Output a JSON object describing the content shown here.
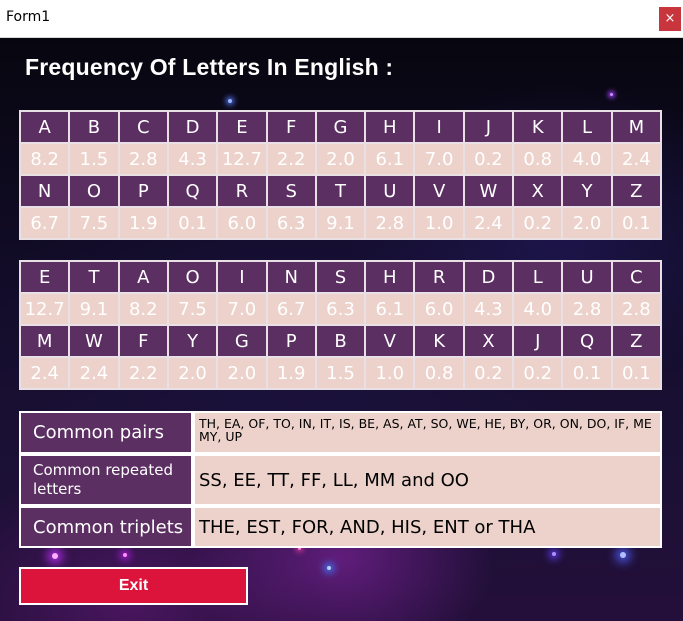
{
  "window": {
    "title": "Form1",
    "close_label": "×"
  },
  "heading": "Frequency Of Letters In English :",
  "alphabetical": [
    {
      "letter": "A",
      "freq": "8.2"
    },
    {
      "letter": "B",
      "freq": "1.5"
    },
    {
      "letter": "C",
      "freq": "2.8"
    },
    {
      "letter": "D",
      "freq": "4.3"
    },
    {
      "letter": "E",
      "freq": "12.7"
    },
    {
      "letter": "F",
      "freq": "2.2"
    },
    {
      "letter": "G",
      "freq": "2.0"
    },
    {
      "letter": "H",
      "freq": "6.1"
    },
    {
      "letter": "I",
      "freq": "7.0"
    },
    {
      "letter": "J",
      "freq": "0.2"
    },
    {
      "letter": "K",
      "freq": "0.8"
    },
    {
      "letter": "L",
      "freq": "4.0"
    },
    {
      "letter": "M",
      "freq": "2.4"
    },
    {
      "letter": "N",
      "freq": "6.7"
    },
    {
      "letter": "O",
      "freq": "7.5"
    },
    {
      "letter": "P",
      "freq": "1.9"
    },
    {
      "letter": "Q",
      "freq": "0.1"
    },
    {
      "letter": "R",
      "freq": "6.0"
    },
    {
      "letter": "S",
      "freq": "6.3"
    },
    {
      "letter": "T",
      "freq": "9.1"
    },
    {
      "letter": "U",
      "freq": "2.8"
    },
    {
      "letter": "V",
      "freq": "1.0"
    },
    {
      "letter": "W",
      "freq": "2.4"
    },
    {
      "letter": "X",
      "freq": "0.2"
    },
    {
      "letter": "Y",
      "freq": "2.0"
    },
    {
      "letter": "Z",
      "freq": "0.1"
    }
  ],
  "by_frequency": [
    {
      "letter": "E",
      "freq": "12.7"
    },
    {
      "letter": "T",
      "freq": "9.1"
    },
    {
      "letter": "A",
      "freq": "8.2"
    },
    {
      "letter": "O",
      "freq": "7.5"
    },
    {
      "letter": "I",
      "freq": "7.0"
    },
    {
      "letter": "N",
      "freq": "6.7"
    },
    {
      "letter": "S",
      "freq": "6.3"
    },
    {
      "letter": "H",
      "freq": "6.1"
    },
    {
      "letter": "R",
      "freq": "6.0"
    },
    {
      "letter": "D",
      "freq": "4.3"
    },
    {
      "letter": "L",
      "freq": "4.0"
    },
    {
      "letter": "U",
      "freq": "2.8"
    },
    {
      "letter": "C",
      "freq": "2.8"
    },
    {
      "letter": "M",
      "freq": "2.4"
    },
    {
      "letter": "W",
      "freq": "2.4"
    },
    {
      "letter": "F",
      "freq": "2.2"
    },
    {
      "letter": "Y",
      "freq": "2.0"
    },
    {
      "letter": "G",
      "freq": "2.0"
    },
    {
      "letter": "P",
      "freq": "1.9"
    },
    {
      "letter": "B",
      "freq": "1.5"
    },
    {
      "letter": "V",
      "freq": "1.0"
    },
    {
      "letter": "K",
      "freq": "0.8"
    },
    {
      "letter": "X",
      "freq": "0.2"
    },
    {
      "letter": "J",
      "freq": "0.2"
    },
    {
      "letter": "Q",
      "freq": "0.1"
    },
    {
      "letter": "Z",
      "freq": "0.1"
    }
  ],
  "info": {
    "pairs_label": "Common pairs",
    "pairs_value": "TH, EA, OF, TO, IN, IT, IS, BE, AS, AT, SO, WE, HE, BY, OR, ON, DO, IF,  ME MY, UP",
    "repeated_label": "Common repeated letters",
    "repeated_value": "SS, EE, TT, FF, LL, MM and OO",
    "triplets_label": "Common triplets",
    "triplets_value": "THE, EST, FOR, AND, HIS, ENT or THA"
  },
  "exit_label": "Exit",
  "colors": {
    "header_cell": "#5b2f62",
    "value_cell": "#ecd2cb",
    "exit_button": "#dc143c",
    "close_button": "#c9353d"
  }
}
